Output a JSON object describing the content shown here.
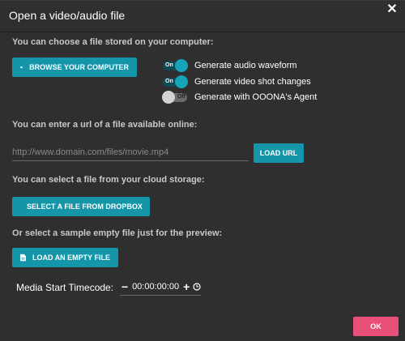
{
  "dialog": {
    "title": "Open a video/audio file",
    "close_icon": "close-icon"
  },
  "computer": {
    "label": "You can choose a file stored on your computer:",
    "browse_button": "BROWSE YOUR COMPUTER",
    "browse_icon": "folder-open-icon"
  },
  "toggles": [
    {
      "state_label": "On",
      "text": "Generate audio waveform",
      "on": true
    },
    {
      "state_label": "On",
      "text": "Generate video shot changes",
      "on": true
    },
    {
      "state_label": "Off",
      "text": "Generate with OOONA's Agent",
      "on": false
    }
  ],
  "url": {
    "label": "You can enter a url of a file available online:",
    "placeholder": "http://www.domain.com/files/movie.mp4",
    "value": "",
    "load_button": "LOAD URL"
  },
  "cloud": {
    "label": "You can select a file from your cloud storage:",
    "dropbox_button": "SELECT A FILE FROM DROPBOX",
    "dropbox_icon": "dropbox-icon"
  },
  "sample": {
    "label": "Or select a sample empty file just for the preview:",
    "empty_button": "LOAD AN EMPTY FILE",
    "empty_icon": "file-icon"
  },
  "timecode": {
    "label": "Media Start Timecode:",
    "value": "00:00:00:00",
    "minus_icon": "minus-icon",
    "plus_icon": "plus-icon",
    "clock_icon": "clock-icon"
  },
  "footer": {
    "ok_button": "OK"
  },
  "colors": {
    "background": "#2f2f2f",
    "primary_button": "#1596a8",
    "ok_button": "#e8507a",
    "toggle_on_knob": "#17a3b8"
  }
}
